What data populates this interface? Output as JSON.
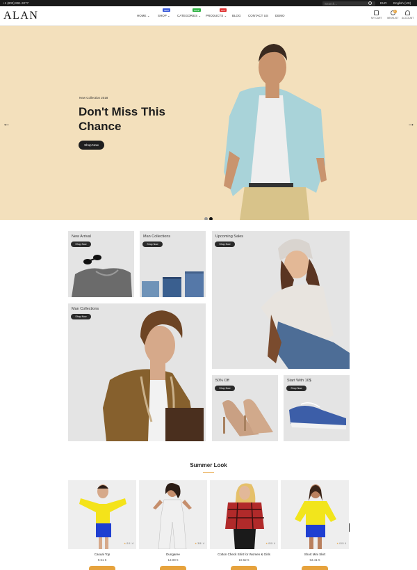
{
  "topbar": {
    "phone": "+1 (800) 891-3277",
    "search_placeholder": "Search...",
    "currency": "EUR",
    "language": "English (US)"
  },
  "header": {
    "logo": "ALAN",
    "nav": [
      {
        "label": "HOME",
        "badge": ""
      },
      {
        "label": "SHOP",
        "badge": "NEW"
      },
      {
        "label": "CATEGORIES",
        "badge": "SALE"
      },
      {
        "label": "PRODUCTS",
        "badge": "HOT"
      },
      {
        "label": "BLOG",
        "badge": ""
      },
      {
        "label": "CONTACT US",
        "badge": ""
      },
      {
        "label": "DEMO",
        "badge": ""
      }
    ],
    "cart_label": "MY CART",
    "wishlist_label": "WISHLIST",
    "wishlist_count": "0",
    "account_label": "ACCOUNT"
  },
  "hero": {
    "kicker": "New Collection 2018",
    "title": "Don't Miss This Chance",
    "button": "Shop Now",
    "prev": "←",
    "next": "→"
  },
  "collections": [
    {
      "label": "New Arrival",
      "button": "Shop Now"
    },
    {
      "label": "Man Collections",
      "button": "Shop Now"
    },
    {
      "label": "Upcoming Sales",
      "button": "Shop Now"
    },
    {
      "label": "Man Collections",
      "button": "Shop Now"
    },
    {
      "label": "50% Off",
      "button": "Shop Now"
    },
    {
      "label": "Start With 10$",
      "button": "Shop Now"
    }
  ],
  "summer": {
    "title": "Summer Look",
    "products": [
      {
        "name": "Casual Top",
        "price": "9.61 €",
        "rating": "0.0 / 4"
      },
      {
        "name": "Dungaree",
        "price": "13.08 €",
        "rating": "3.8 / 4"
      },
      {
        "name": "Cotton Check Shirt for Women & Girls",
        "price": "19.62 €",
        "rating": "0.0 / 4"
      },
      {
        "name": "Short Mini Skirt",
        "price": "63.41 €",
        "rating": "0.0 / 4"
      }
    ]
  },
  "colors": {
    "accent": "#e6a23c",
    "hero_bg": "#f3e0bc",
    "dark": "#1f1f1f"
  }
}
